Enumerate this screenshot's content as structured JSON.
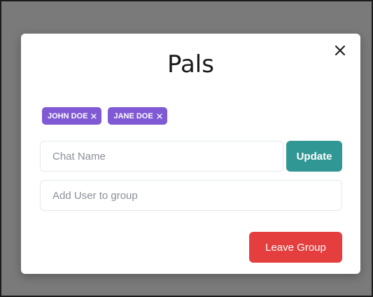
{
  "modal": {
    "title": "Pals",
    "close_icon": "close-icon"
  },
  "users": [
    {
      "name": "JOHN DOE",
      "remove_icon": "close-icon"
    },
    {
      "name": "JANE DOE",
      "remove_icon": "close-icon"
    }
  ],
  "chat_name_input": {
    "placeholder": "Chat Name",
    "value": ""
  },
  "add_user_input": {
    "placeholder": "Add User to group",
    "value": ""
  },
  "buttons": {
    "update_label": "Update",
    "leave_label": "Leave Group"
  },
  "colors": {
    "overlay": "#7a7a7a",
    "tag": "#805ad5",
    "update": "#319795",
    "leave": "#e53e3e"
  }
}
